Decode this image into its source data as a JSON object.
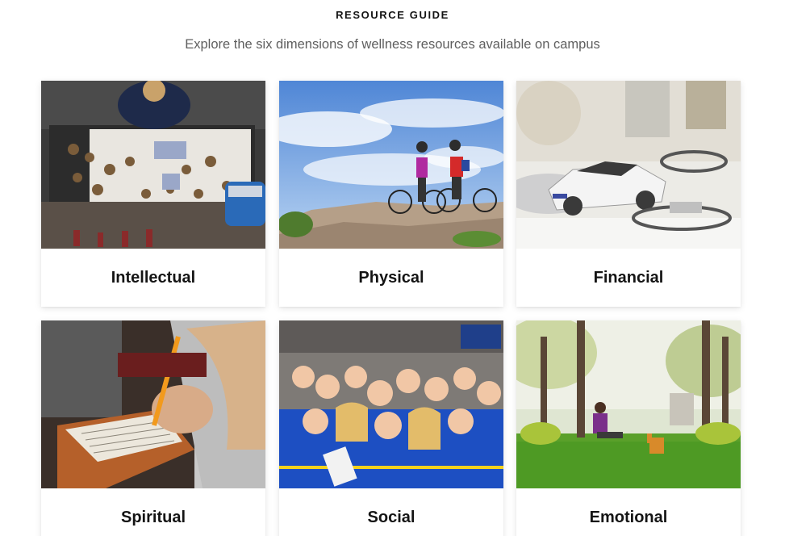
{
  "header": {
    "eyebrow": "RESOURCE GUIDE",
    "subtitle": "Explore the six dimensions of wellness resources available on campus"
  },
  "cards": [
    {
      "label": "Intellectual"
    },
    {
      "label": "Physical"
    },
    {
      "label": "Financial"
    },
    {
      "label": "Spiritual"
    },
    {
      "label": "Social"
    },
    {
      "label": "Emotional"
    }
  ]
}
